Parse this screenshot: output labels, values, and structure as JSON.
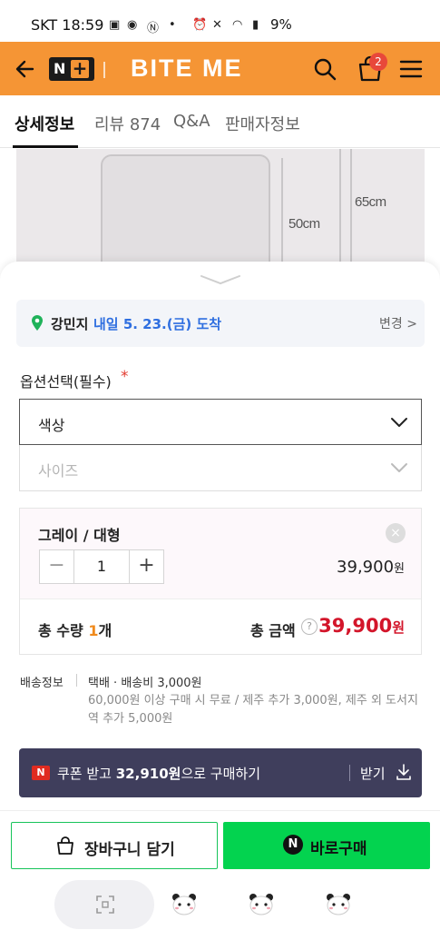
{
  "status_bar": {
    "carrier_time": "SKT 18:59",
    "battery": "9%"
  },
  "header": {
    "brand": "BITE ME",
    "nplus_n": "N",
    "nplus_plus": "+",
    "cart_count": "2",
    "accent_color": "#f59535"
  },
  "tabs": [
    {
      "label": "상세정보",
      "active": true
    },
    {
      "label": "리뷰 874",
      "active": false
    },
    {
      "label": "Q&A",
      "active": false
    },
    {
      "label": "판매자정보",
      "active": false
    }
  ],
  "product_image": {
    "dim_height": "50cm",
    "dim_total": "65cm"
  },
  "delivery": {
    "name": "강민지",
    "eta": "내일 5. 23.(금) 도착",
    "change": "변경 >"
  },
  "options": {
    "title": "옵션선택(필수)",
    "required_mark": "*",
    "color_select": "색상",
    "size_select": "사이즈"
  },
  "selected_item": {
    "name": "그레이 / 대형",
    "remove": "×",
    "minus": "−",
    "plus": "+",
    "quantity": "1",
    "price": "39,900",
    "price_unit": "원"
  },
  "totals": {
    "qty_label": "총 수량",
    "qty_value": "1",
    "qty_unit": "개",
    "amount_label": "총 금액",
    "help": "?",
    "amount": "39,900",
    "amount_unit": "원",
    "amount_color": "#d3152a"
  },
  "shipping": {
    "label": "배송정보",
    "main": "택배 · 배송비 3,000원",
    "note": "60,000원 이상 구매 시 무료 / 제주 추가 3,000원, 제주 외 도서지역 추가 5,000원"
  },
  "coupon": {
    "badge": "N",
    "prefix": "쿠폰 받고",
    "price": "32,910원",
    "suffix": "으로 구매하기",
    "get": "받기"
  },
  "actions": {
    "cart": "장바구니 담기",
    "buy_icon": "N",
    "buy": "바로구매",
    "buy_color": "#03d34f"
  }
}
